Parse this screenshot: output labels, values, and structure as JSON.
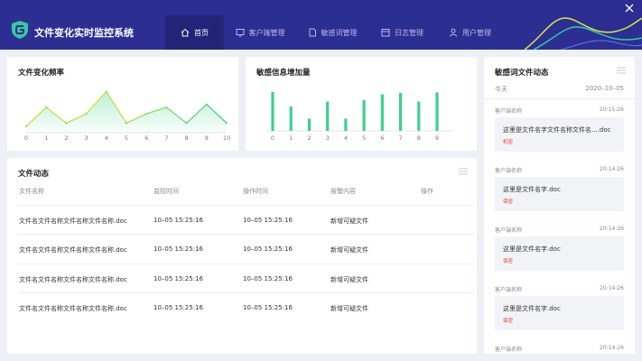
{
  "app": {
    "title": "文件变化实时监控系统"
  },
  "nav": [
    {
      "label": "首页",
      "icon": "home-icon",
      "active": true
    },
    {
      "label": "客户端管理",
      "icon": "monitor-icon",
      "active": false
    },
    {
      "label": "敏感词管理",
      "icon": "document-icon",
      "active": false
    },
    {
      "label": "日志管理",
      "icon": "calendar-icon",
      "active": false
    },
    {
      "label": "用户管理",
      "icon": "user-icon",
      "active": false
    }
  ],
  "colors": {
    "header": "#2c2e92",
    "nav_active": "#222478",
    "line_green": "#3ecf8e",
    "line_yellow": "#c4e23b",
    "tag_red": "#e04444"
  },
  "freq_card": {
    "title": "文件变化频率",
    "chart_data": {
      "type": "area",
      "x": [
        0,
        1,
        2,
        3,
        4,
        5,
        6,
        7,
        8,
        9,
        10
      ],
      "values": [
        1,
        4,
        1.5,
        3,
        6.5,
        1.5,
        3,
        4,
        1.5,
        4.5,
        1.5
      ],
      "x_ticks": [
        "0",
        "1",
        "2",
        "3",
        "4",
        "5",
        "6",
        "7",
        "8",
        "9",
        "10"
      ],
      "ylim": [
        0,
        8
      ]
    }
  },
  "increase_card": {
    "title": "敏感信息增加量",
    "chart_data": {
      "type": "bar",
      "categories": [
        "0",
        "1",
        "2",
        "3",
        "4",
        "5",
        "6",
        "7",
        "8",
        "9"
      ],
      "values": [
        8,
        5,
        2.5,
        6,
        2.5,
        6.3,
        7.5,
        7.8,
        6,
        7.9
      ],
      "ylim": [
        0,
        10
      ]
    }
  },
  "files_card": {
    "title": "文件动态",
    "columns": [
      "文件名称",
      "监控时间",
      "操作时间",
      "报警内容",
      "操作"
    ],
    "rows": [
      [
        "文件名文件名称文件名称文件名称.doc",
        "10–05 15:25:16",
        "10–05 15:25:16",
        "新增可疑文件",
        ""
      ],
      [
        "文件名文件名称文件名称文件名称.doc",
        "10–05 15:25:16",
        "10–05 15:25:16",
        "新增可疑文件",
        ""
      ],
      [
        "文件名文件名称文件名称文件名称.doc",
        "10–05 15:25:16",
        "10–05 15:25:16",
        "新增可疑文件",
        ""
      ],
      [
        "文件名文件名称文件名称文件名称.doc",
        "10–05 15:25:16",
        "10–05 15:25:16",
        "新增可疑文件",
        ""
      ]
    ]
  },
  "sensitive_card": {
    "title": "敏感词文件动态",
    "today_label": "今天",
    "today_date": "2020–10–05",
    "messages": [
      {
        "client": "客户端名称",
        "time": "20:15:26",
        "text": "这里是文件名字文件名称文件名....doc",
        "tag": "机密"
      },
      {
        "client": "客户端名称",
        "time": "20:14:26",
        "text": "这里是文件名字.doc",
        "tag": "保密"
      },
      {
        "client": "客户端名称",
        "time": "20:14:26",
        "text": "这里是文件名字.doc",
        "tag": "保密"
      },
      {
        "client": "客户端名称",
        "time": "20:14:26",
        "text": "这里是文件名字.doc",
        "tag": "保密"
      },
      {
        "client": "客户端名称",
        "time": "20:14:26",
        "text": "",
        "tag": ""
      }
    ]
  }
}
